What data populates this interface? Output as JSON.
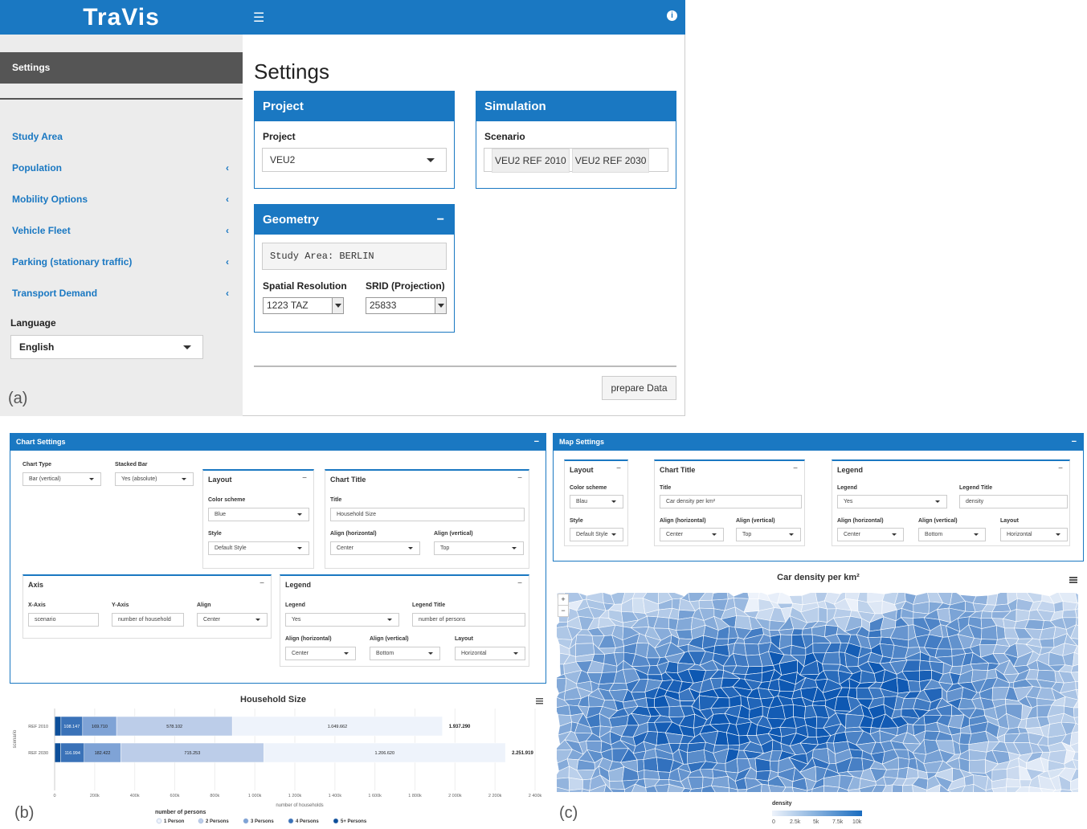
{
  "app": {
    "logo": "TraVis",
    "menu_icon": "hamburger-icon",
    "info_icon": "info-icon"
  },
  "sidebar": {
    "active": "Settings",
    "items": [
      {
        "label": "Study Area",
        "chevron": false
      },
      {
        "label": "Population",
        "chevron": true
      },
      {
        "label": "Mobility Options",
        "chevron": true
      },
      {
        "label": "Vehicle Fleet",
        "chevron": true
      },
      {
        "label": "Parking (stationary traffic)",
        "chevron": true
      },
      {
        "label": "Transport Demand",
        "chevron": true
      }
    ],
    "chevron_glyph": "‹",
    "language_label": "Language",
    "language_value": "English"
  },
  "main": {
    "title": "Settings",
    "project": {
      "header": "Project",
      "label": "Project",
      "value": "VEU2"
    },
    "simulation": {
      "header": "Simulation",
      "label": "Scenario",
      "tags": [
        "VEU2 REF 2010",
        "VEU2 REF 2030"
      ]
    },
    "geometry": {
      "header": "Geometry",
      "collapse": "−",
      "study_area": "Study Area: BERLIN",
      "res_label": "Spatial Resolution",
      "res_value": "1223 TAZ",
      "srid_label": "SRID (Projection)",
      "srid_value": "25833"
    },
    "prepare_button": "prepare Data"
  },
  "panel_labels": {
    "a": "(a)",
    "b": "(b)",
    "c": "(c)"
  },
  "chart_settings": {
    "header": "Chart Settings",
    "collapse": "−",
    "chart_type_label": "Chart Type",
    "chart_type_value": "Bar (vertical)",
    "stacked_label": "Stacked Bar",
    "stacked_value": "Yes (absolute)",
    "layout": {
      "title": "Layout",
      "color_label": "Color scheme",
      "color_value": "Blue",
      "style_label": "Style",
      "style_value": "Default Style"
    },
    "chart_title": {
      "title": "Chart Title",
      "title_label": "Title",
      "title_value": "Household Size",
      "alignh_label": "Align (horizontal)",
      "alignh_value": "Center",
      "alignv_label": "Align (vertical)",
      "alignv_value": "Top"
    },
    "axis": {
      "title": "Axis",
      "x_label": "X-Axis",
      "x_value": "scenario",
      "y_label": "Y-Axis",
      "y_value": "number of household",
      "align_label": "Align",
      "align_value": "Center"
    },
    "legend": {
      "title": "Legend",
      "legend_label": "Legend",
      "legend_value": "Yes",
      "ltitle_label": "Legend Title",
      "ltitle_value": "number of persons",
      "alignh_label": "Align (horizontal)",
      "alignh_value": "Center",
      "alignv_label": "Align (vertical)",
      "alignv_value": "Bottom",
      "layout_label": "Layout",
      "layout_value": "Horizontal"
    }
  },
  "map_settings": {
    "header": "Map Settings",
    "collapse": "−",
    "layout": {
      "title": "Layout",
      "color_label": "Color scheme",
      "color_value": "Blau",
      "style_label": "Style",
      "style_value": "Default Style"
    },
    "chart_title": {
      "title": "Chart Title",
      "title_label": "Title",
      "title_value": "Car density per km²",
      "alignh_label": "Align (horizontal)",
      "alignh_value": "Center",
      "alignv_label": "Align (vertical)",
      "alignv_value": "Top"
    },
    "legend": {
      "title": "Legend",
      "legend_label": "Legend",
      "legend_value": "Yes",
      "ltitle_label": "Legend Title",
      "ltitle_value": "density",
      "alignh_label": "Align (horizontal)",
      "alignh_value": "Center",
      "alignv_label": "Align (vertical)",
      "alignv_value": "Bottom",
      "layout_label": "Layout",
      "layout_value": "Horizontal"
    }
  },
  "map": {
    "title": "Car density per km²",
    "zoom_in": "+",
    "zoom_out": "−",
    "legend_title": "density",
    "legend_ticks": [
      "0",
      "2.5k",
      "5k",
      "7.5k",
      "10k"
    ],
    "menu_icon": "hamburger-icon"
  },
  "chart_data": {
    "type": "bar",
    "orientation": "horizontal",
    "stacked": true,
    "title": "Household Size",
    "xlabel": "number of households",
    "ylabel": "scenario",
    "categories": [
      "REF 2010",
      "REF 2030"
    ],
    "xlim": [
      0,
      2400000
    ],
    "xticks": [
      "0",
      "200k",
      "400k",
      "600k",
      "800k",
      "1 000k",
      "1 200k",
      "1 400k",
      "1 600k",
      "1 800k",
      "2 000k",
      "2 200k",
      "2 400k"
    ],
    "legend_title": "number of persons",
    "legend_position": "bottom",
    "series": [
      {
        "name": "1 Person",
        "color": "#eef3fb",
        "values": [
          1049662,
          1206620
        ],
        "labels": [
          "1.049.662",
          "1.206.620"
        ]
      },
      {
        "name": "2 Persons",
        "color": "#bccde9",
        "values": [
          578102,
          715253
        ],
        "labels": [
          "578.102",
          "715.253"
        ]
      },
      {
        "name": "3 Persons",
        "color": "#7fa3d6",
        "values": [
          169710,
          182422
        ],
        "labels": [
          "169.710",
          "182.422"
        ]
      },
      {
        "name": "4 Persons",
        "color": "#3a72b8",
        "values": [
          108147,
          116994
        ],
        "labels": [
          "108.147",
          "116.994"
        ]
      },
      {
        "name": "5+ Persons",
        "color": "#0d4f9a",
        "values": [
          31669,
          30630
        ],
        "labels": [
          "",
          ""
        ]
      }
    ],
    "totals": [
      "1.937.290",
      "2.251.919"
    ]
  }
}
